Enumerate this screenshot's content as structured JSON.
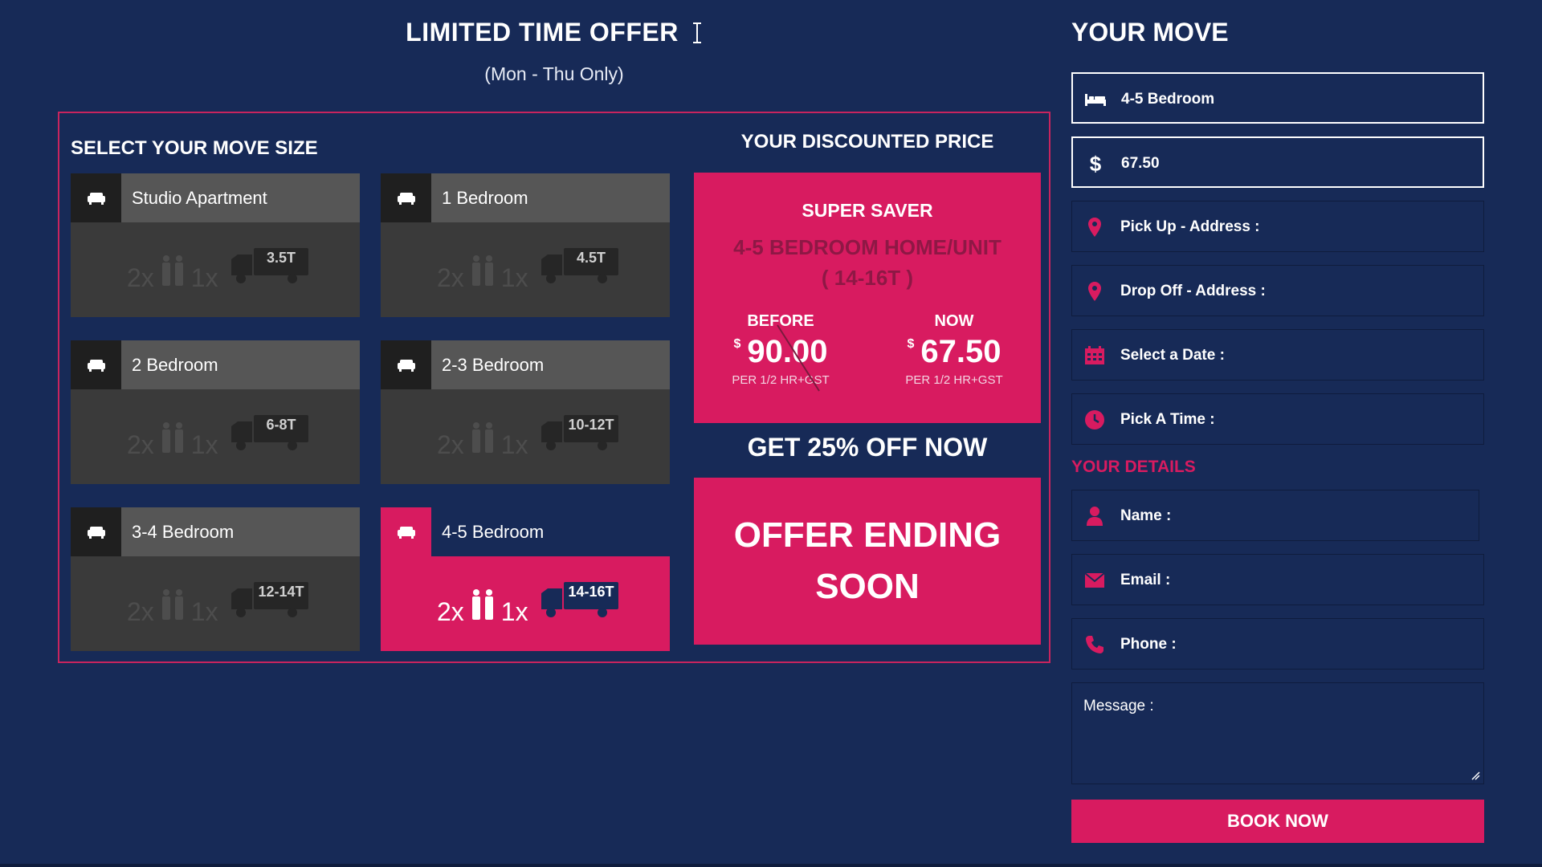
{
  "offer": {
    "title": "LIMITED TIME OFFER",
    "subtitle": "(Mon - Thu Only)"
  },
  "move_size": {
    "title": "SELECT YOUR MOVE SIZE",
    "crew_count": "2x",
    "truck_count": "1x",
    "options": [
      {
        "label": "Studio Apartment",
        "truck": "3.5T",
        "selected": false
      },
      {
        "label": "1 Bedroom",
        "truck": "4.5T",
        "selected": false
      },
      {
        "label": "2 Bedroom",
        "truck": "6-8T",
        "selected": false
      },
      {
        "label": "2-3 Bedroom",
        "truck": "10-12T",
        "selected": false
      },
      {
        "label": "3-4 Bedroom",
        "truck": "12-14T",
        "selected": false
      },
      {
        "label": "4-5 Bedroom",
        "truck": "14-16T",
        "selected": true
      }
    ]
  },
  "discount": {
    "title": "YOUR DISCOUNTED PRICE",
    "saver_label": "SUPER SAVER",
    "home_line1": "4-5 BEDROOM HOME/UNIT",
    "home_line2": "( 14-16T )",
    "before_label": "BEFORE",
    "before_currency": "$",
    "before_price": "90.00",
    "before_note": "PER 1/2 HR+GST",
    "now_label": "NOW",
    "now_currency": "$",
    "now_price": "67.50",
    "now_note": "PER 1/2 HR+GST",
    "get_off": "GET 25% OFF NOW",
    "ending": "OFFER ENDING SOON"
  },
  "your_move": {
    "title": "YOUR MOVE",
    "size_value": "4-5 Bedroom",
    "price_symbol": "$",
    "price_value": "67.50",
    "pickup_placeholder": "Pick Up - Address :",
    "dropoff_placeholder": "Drop Off - Address :",
    "date_placeholder": "Select a Date :",
    "time_placeholder": "Pick A Time :"
  },
  "details": {
    "title": "YOUR DETAILS",
    "name_placeholder": "Name :",
    "email_placeholder": "Email :",
    "phone_placeholder": "Phone :",
    "message_placeholder": "Message :"
  },
  "book_label": "BOOK NOW",
  "colors": {
    "background": "#172a57",
    "accent": "#d81b60",
    "card": "#3a3a3a"
  },
  "icons": {
    "cursor": "text-cursor-icon",
    "move_option": "sofa-icon",
    "crew": "two-people-icon",
    "truck": "truck-icon",
    "size": "bed-icon",
    "price": "dollar-icon",
    "pickup": "map-pin-icon",
    "dropoff": "map-pin-icon",
    "date": "calendar-icon",
    "time": "clock-icon",
    "name": "user-icon",
    "email": "envelope-icon",
    "phone": "phone-icon",
    "message_resize": "resize-handle-icon"
  }
}
